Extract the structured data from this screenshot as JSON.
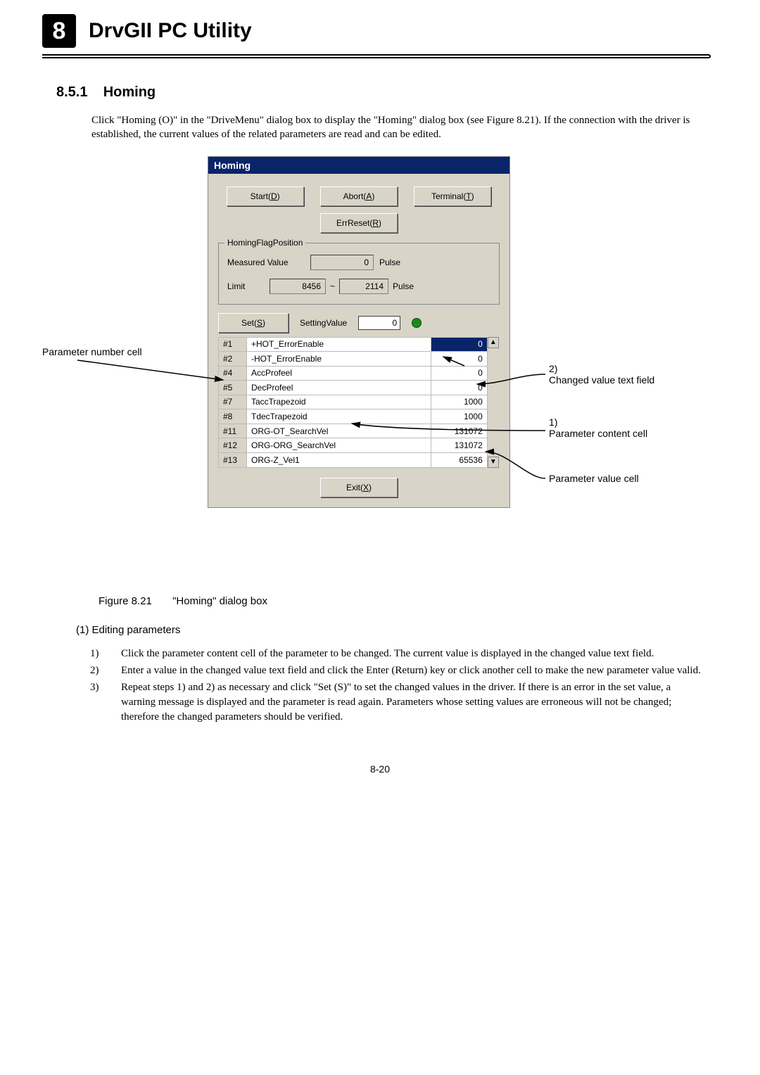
{
  "chapter": {
    "num": "8",
    "title": "DrvGII PC Utility"
  },
  "section": {
    "num": "8.5.1",
    "title": "Homing"
  },
  "intro": "Click \"Homing (O)\" in the \"DriveMenu\" dialog box to display the \"Homing\" dialog box (see Figure 8.21). If the connection with the driver is established, the current values of the related parameters are read and can be edited.",
  "dialog": {
    "title": "Homing",
    "buttons": {
      "start": "Start(D)",
      "abort": "Abort(A)",
      "terminal": "Terminal(T)",
      "errreset": "ErrReset(R)",
      "set": "Set(S)",
      "exit": "Exit(X)"
    },
    "group_label": "HomingFlagPosition",
    "measured_label": "Measured Value",
    "measured_value": "0",
    "pulse": "Pulse",
    "limit_label": "Limit",
    "limit_low": "8456",
    "tilde": "~",
    "limit_high": "2114",
    "settingvalue_label": "SettingValue",
    "settingvalue_value": "0",
    "params": [
      {
        "n": "#1",
        "name": "+HOT_ErrorEnable",
        "val": "0",
        "sel": true
      },
      {
        "n": "#2",
        "name": "-HOT_ErrorEnable",
        "val": "0"
      },
      {
        "n": "#4",
        "name": "AccProfeel",
        "val": "0"
      },
      {
        "n": "#5",
        "name": "DecProfeel",
        "val": "0"
      },
      {
        "n": "#7",
        "name": "TaccTrapezoid",
        "val": "1000"
      },
      {
        "n": "#8",
        "name": "TdecTrapezoid",
        "val": "1000"
      },
      {
        "n": "#11",
        "name": "ORG-OT_SearchVel",
        "val": "131072"
      },
      {
        "n": "#12",
        "name": "ORG-ORG_SearchVel",
        "val": "131072"
      },
      {
        "n": "#13",
        "name": "ORG-Z_Vel1",
        "val": "65536"
      }
    ]
  },
  "callouts": {
    "param_num_cell": "Parameter number cell",
    "changed_value": "2)\nChanged value text field",
    "param_content": "1)\nParameter content cell",
    "param_value": "Parameter value cell"
  },
  "figure_caption": {
    "ref": "Figure 8.21",
    "text": "\"Homing\" dialog box"
  },
  "editing_heading": "(1)  Editing parameters",
  "steps": {
    "s1": "Click the parameter content cell of the parameter to be changed. The current value is displayed in the changed value text field.",
    "s2": "Enter a value in the changed value text field and click the Enter (Return) key or click another cell to make the new parameter value valid.",
    "s3": "Repeat steps 1) and 2) as necessary and click \"Set (S)\" to set the changed values in the driver. If there is an error in the set value, a warning message is displayed and the parameter is read again. Parameters whose setting values are erroneous will not be changed; therefore the changed parameters should be verified."
  },
  "page_num": "8-20"
}
